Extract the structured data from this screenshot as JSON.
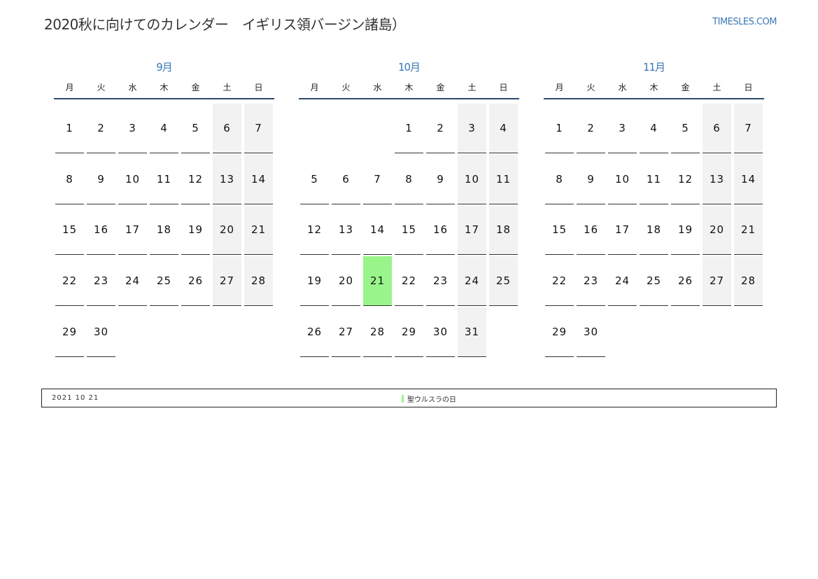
{
  "header": {
    "title": "2020秋に向けてのカレンダー　イギリス領バージン諸島）",
    "site": "TIMESLES.COM"
  },
  "weekdays": [
    "月",
    "火",
    "水",
    "木",
    "金",
    "土",
    "日"
  ],
  "months": [
    {
      "name": "9月",
      "offset": 0,
      "days": 30
    },
    {
      "name": "10月",
      "offset": 3,
      "days": 31,
      "holidays": [
        21
      ]
    },
    {
      "name": "11月",
      "offset": 0,
      "days": 30
    }
  ],
  "footer": {
    "date": "2021  10  21",
    "event": "聖ウルスラの日"
  },
  "colors": {
    "accent": "#3a78b5",
    "holiday": "#99f58a",
    "weekend": "#f2f2f2"
  }
}
